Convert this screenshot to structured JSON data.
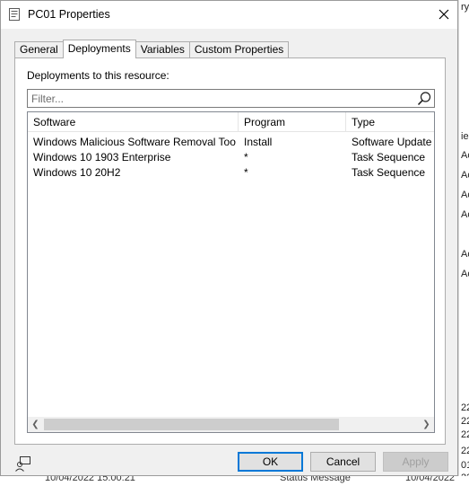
{
  "window": {
    "title": "PC01 Properties"
  },
  "tabs": [
    {
      "label": "General"
    },
    {
      "label": "Deployments"
    },
    {
      "label": "Variables"
    },
    {
      "label": "Custom Properties"
    }
  ],
  "panel": {
    "label": "Deployments to this resource:",
    "filter_placeholder": "Filter..."
  },
  "table": {
    "columns": [
      "Software",
      "Program",
      "Type"
    ],
    "rows": [
      {
        "software": "Windows Malicious Software Removal Tool x...",
        "program": "Install",
        "type": "Software Update"
      },
      {
        "software": "Windows 10 1903 Enterprise",
        "program": "*",
        "type": "Task Sequence"
      },
      {
        "software": "Windows 10 20H2",
        "program": "*",
        "type": "Task Sequence"
      }
    ]
  },
  "buttons": {
    "ok": "OK",
    "cancel": "Cancel",
    "apply": "Apply"
  },
  "background": {
    "right_fragments": [
      "ry",
      "ie",
      "Ac",
      "Ac",
      "Ac",
      "Ac",
      "Ac",
      "Ac",
      "22",
      "22",
      "22",
      "22",
      "01",
      "22"
    ],
    "bottom_fragments": [
      "10/04/2022 15:00:21",
      "Status Message",
      "10/04/2022"
    ]
  }
}
